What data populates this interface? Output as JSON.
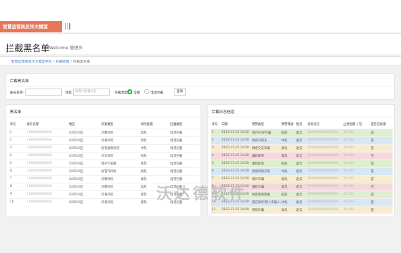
{
  "brand": {
    "title": "智慧运营商反诈大模型"
  },
  "header": {
    "title": "拦截黑名单",
    "welcome": "Welcome 管理员"
  },
  "breadcrumb": {
    "root": "智慧运营商反诈大模型平台",
    "parent": "拦截管理",
    "current": "拦截黑名单"
  },
  "filter": {
    "title": "拦截黑名单",
    "number_label": "账号名称:",
    "region_label": "地区",
    "region_placeholder": "如贵州省遵义区",
    "type_label": "拦截类型",
    "option_all": "全部",
    "option_phone": "电话拦截",
    "query_button": "查询"
  },
  "blacklist": {
    "title": "黑名单",
    "columns": [
      "序号",
      "账号名称",
      "地区",
      "涉案类型",
      "风险程度",
      "拦截类型"
    ],
    "rows": [
      [
        "1",
        "1888888888888",
        "XX市XX区",
        "涉赌风险",
        "高危",
        "电话拦截"
      ],
      [
        "2",
        "1888888888888",
        "XX市XX区",
        "涉黄风险",
        "高危",
        "电话拦截"
      ],
      [
        "3",
        "1888888888888",
        "XX市XX区",
        "投资虚假风险",
        "中危",
        "电话拦截"
      ],
      [
        "4",
        "1888888888888",
        "XX市XX区",
        "涉诈风险",
        "低危",
        "电话拦截"
      ],
      [
        "5",
        "1888888888888",
        "XX市XX区",
        "境外卡密群",
        "紧急",
        "电话拦截"
      ],
      [
        "6",
        "1888888888888",
        "XX市XX区",
        "仿冒诈风险",
        "高危",
        "电话拦截"
      ],
      [
        "7",
        "1888888888888",
        "XX市XX区",
        "涉赌风险",
        "紧急",
        "电话拦截"
      ],
      [
        "8",
        "1888888888888",
        "XX市XX区",
        "涉赌风险",
        "高危",
        "电话拦截"
      ],
      [
        "9",
        "1888888888888",
        "XX市XX区",
        "涉黄风险",
        "紧急",
        "电话拦截"
      ],
      [
        "10",
        "1888888888888",
        "XX市XX区",
        "涉黄风险",
        "紧急",
        "电话拦截"
      ]
    ]
  },
  "log": {
    "title": "拦截日志信息",
    "columns": [
      "序号",
      "日期",
      "预警类型",
      "预警等级",
      "姓名",
      "身份证号",
      "止损金额（元）",
      "是否已处理"
    ],
    "rows": [
      [
        "1",
        "2022-11-15 14:20",
        "境外VOIP诈骗",
        "低危",
        "赵云",
        "1888888888888888",
        "10,000",
        "是"
      ],
      [
        "2",
        "2022-11-15 14:20",
        "仿冒公检法",
        "中危",
        "赵云",
        "1888888888888888",
        "10,000",
        "是"
      ],
      [
        "3",
        "2022-11-15 14:20",
        "网络交友诈骗",
        "高危",
        "赵云",
        "1888888888888888",
        "10,000",
        "是"
      ],
      [
        "4",
        "2022-11-15 14:20",
        "兼职刷单",
        "紧急",
        "赵云",
        "1888888888888888",
        "10,000",
        "否"
      ],
      [
        "5",
        "2022-11-15 14:20",
        "虚假投资",
        "低危",
        "赵云",
        "1888888888888888",
        "10,000",
        "是"
      ],
      [
        "6",
        "2022-11-15 14:20",
        "退保风险交易",
        "中危",
        "赵云",
        "1888888888888888",
        "10,000",
        "是"
      ],
      [
        "7",
        "2022-11-15 14:20",
        "境外诈骗",
        "高危",
        "赵云",
        "1888888888888888",
        "10,000",
        "是"
      ],
      [
        "8",
        "2022-11-15 14:20",
        "兼职诈骗",
        "紧急",
        "赵云",
        "1888888888888888",
        "10,000",
        "否"
      ],
      [
        "9",
        "2022-11-15 14:20",
        "仿冒电商客服",
        "低危",
        "赵云",
        "1888888888888888",
        "10,000",
        "是"
      ],
      [
        "10",
        "2022-11-15 14:20",
        "冒充领导/熟人诈骗人员",
        "中危",
        "赵云",
        "1888888888888888",
        "10,000",
        "是"
      ],
      [
        "11",
        "2022-11-15 14:20",
        "游戏诈骗",
        "高危",
        "赵云",
        "1888888888888888",
        "10,000",
        "是"
      ]
    ],
    "row_colors": [
      "#dfeecf",
      "#d8e7f4",
      "#f8ecd0",
      "#f6d8dc",
      "#dfeecf",
      "#d8e7f4",
      "#f8ecd0",
      "#f6d8dc",
      "#dfeecf",
      "#d8e7f4",
      "#f8ecd0"
    ]
  },
  "watermark": "沃达德软件",
  "colors": {
    "brand": "#e8765a",
    "link": "#3b74c4",
    "radio_active": "#27a844"
  }
}
